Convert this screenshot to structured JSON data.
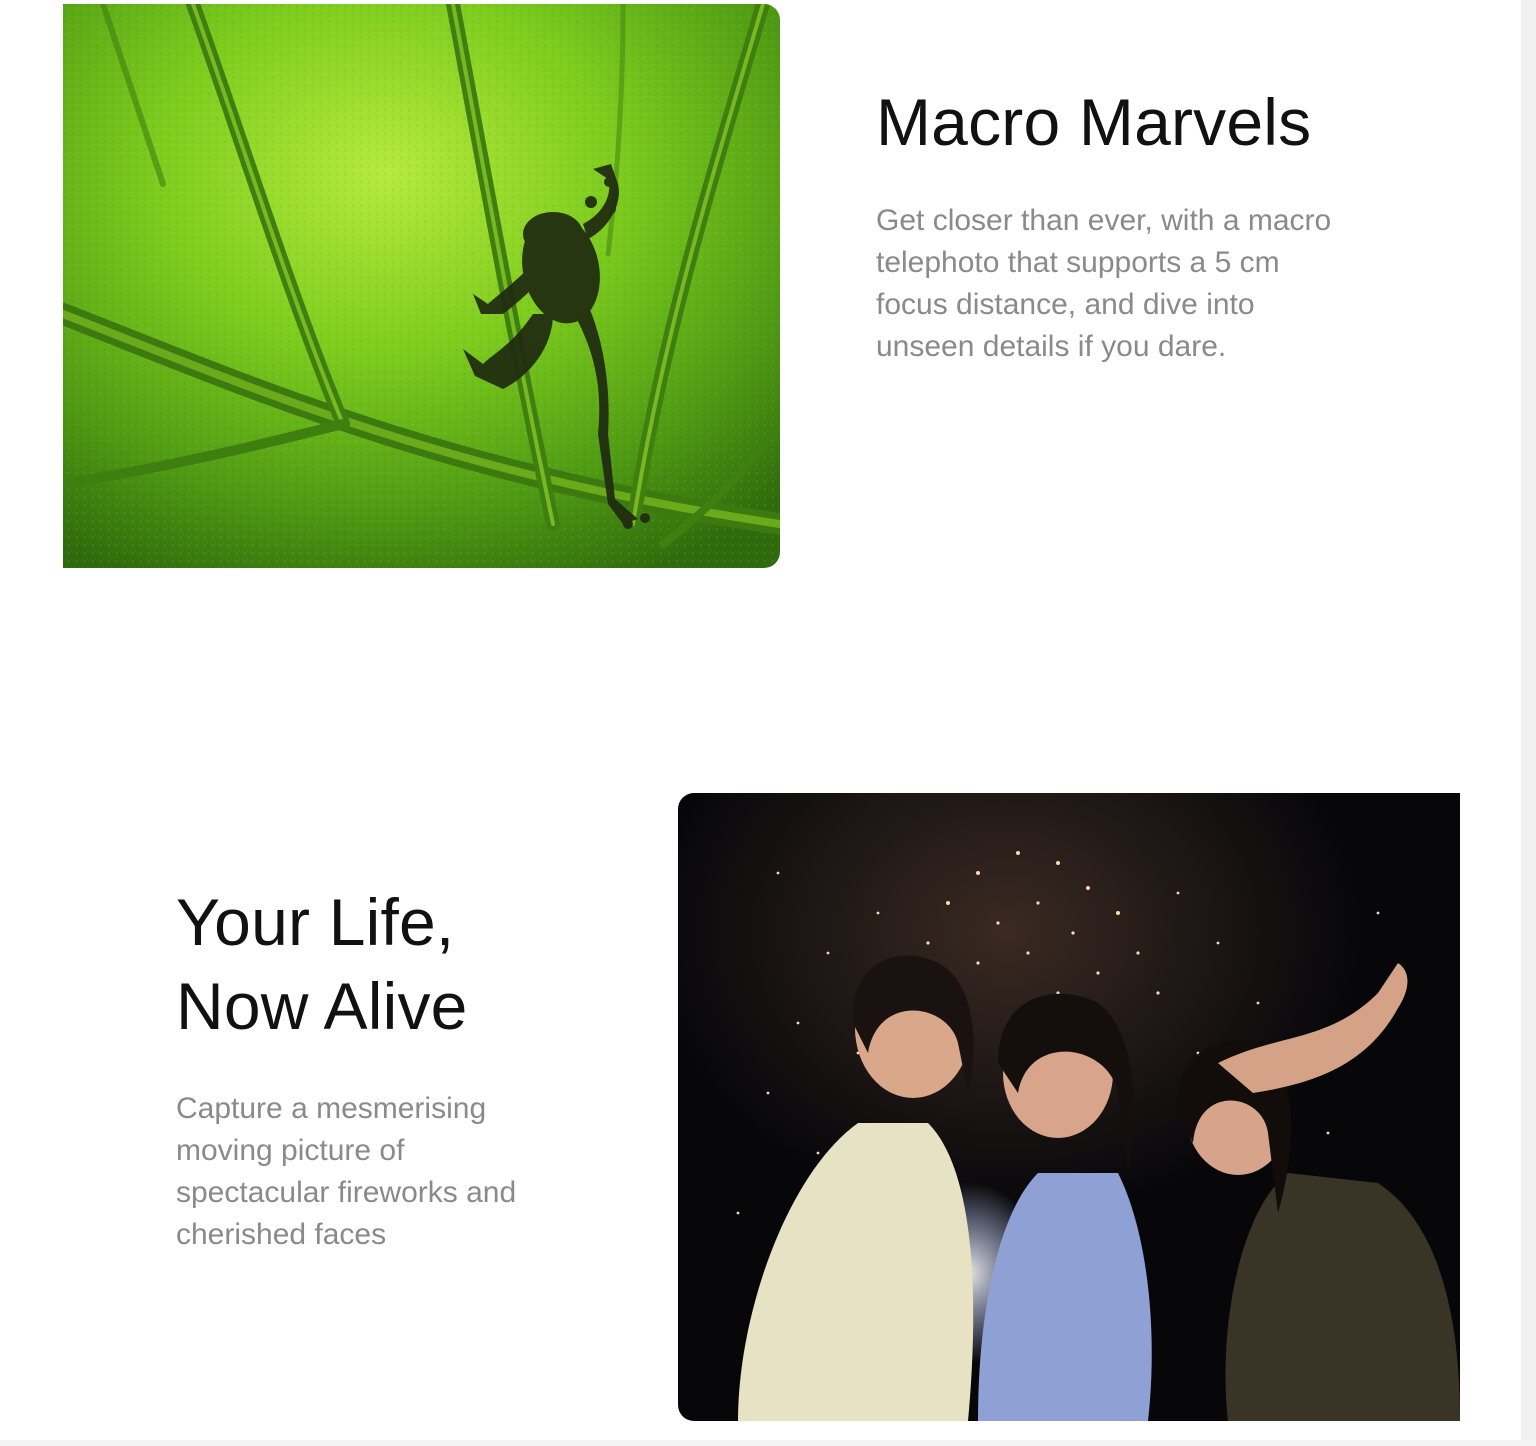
{
  "colors": {
    "heading": "#111111",
    "body_text": "#8a8a8a",
    "background": "#ffffff"
  },
  "sections": [
    {
      "id": "macro",
      "title_lines": [
        "Macro Marvels"
      ],
      "description_lines": [
        "Get closer than ever, with a macro",
        "telephoto that supports a 5 cm",
        "focus distance, and dive into",
        "unseen details if you dare."
      ],
      "image": "frog-silhouette-on-green-leaf"
    },
    {
      "id": "life",
      "title_lines": [
        "Your Life,",
        "Now Alive"
      ],
      "description_lines": [
        "Capture a mesmerising",
        "moving picture of",
        "spectacular fireworks and",
        "cherished faces"
      ],
      "image": "three-women-with-fireworks-at-night"
    }
  ]
}
